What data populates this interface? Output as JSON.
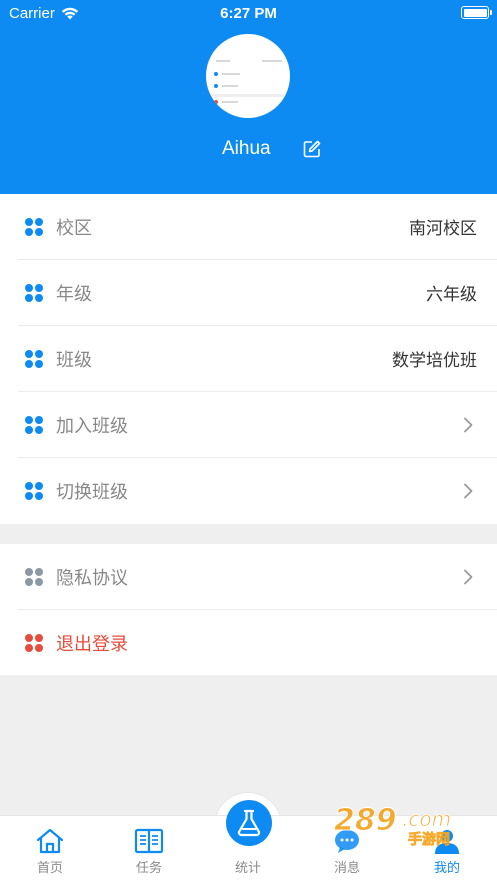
{
  "status_bar": {
    "carrier": "Carrier",
    "time": "6:27 PM"
  },
  "profile": {
    "username": "Aihua"
  },
  "menu_main": [
    {
      "label": "校区",
      "value": "南河校区",
      "icon": "grid-icon",
      "color": "#0d8bf2"
    },
    {
      "label": "年级",
      "value": "六年级",
      "icon": "grid-icon",
      "color": "#0d8bf2"
    },
    {
      "label": "班级",
      "value": "数学培优班",
      "icon": "grid-icon",
      "color": "#0d8bf2"
    },
    {
      "label": "加入班级",
      "icon": "grid-icon",
      "color": "#0d8bf2"
    },
    {
      "label": "切换班级",
      "icon": "grid-icon",
      "color": "#0d8bf2"
    }
  ],
  "menu_secondary": [
    {
      "label": "隐私协议",
      "icon": "grid-icon",
      "color": "#8b98a6"
    },
    {
      "label": "退出登录",
      "icon": "grid-icon",
      "color": "#e74c3c"
    }
  ],
  "tabbar": [
    {
      "label": "首页",
      "icon": "home-icon"
    },
    {
      "label": "任务",
      "icon": "book-icon"
    },
    {
      "label": "统计",
      "icon": "flask-icon"
    },
    {
      "label": "消息",
      "icon": "chat-icon"
    },
    {
      "label": "我的",
      "icon": "user-icon",
      "active": true
    }
  ],
  "watermark": {
    "text": "289.com",
    "subtext": "手游网"
  }
}
